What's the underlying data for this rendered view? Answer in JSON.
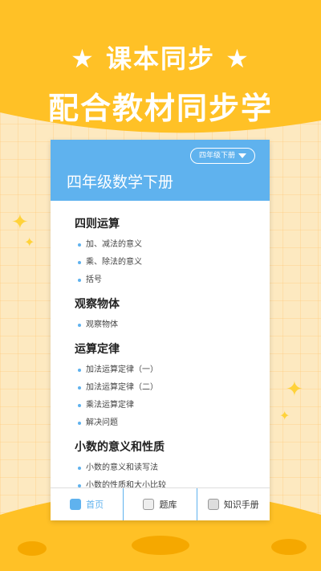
{
  "promo": {
    "line1_text": "课本同步",
    "line2_text": "配合教材同步学"
  },
  "app": {
    "grade_selector": "四年级下册",
    "book_title": "四年级数学下册",
    "sections": [
      {
        "title": "四则运算",
        "items": [
          "加、减法的意义",
          "乘、除法的意义",
          "括号"
        ]
      },
      {
        "title": "观察物体",
        "items": [
          "观察物体"
        ]
      },
      {
        "title": "运算定律",
        "items": [
          "加法运算定律（一）",
          "加法运算定律（二）",
          "乘法运算定律",
          "解决问题"
        ]
      },
      {
        "title": "小数的意义和性质",
        "items": [
          "小数的意义和读写法",
          "小数的性质和大小比较"
        ]
      }
    ],
    "tabs": {
      "home": "首页",
      "questions": "题库",
      "handbook": "知识手册"
    }
  },
  "colors": {
    "accent": "#5fb2ee",
    "background": "#fde9c0",
    "promo_yellow": "#ffc126"
  }
}
